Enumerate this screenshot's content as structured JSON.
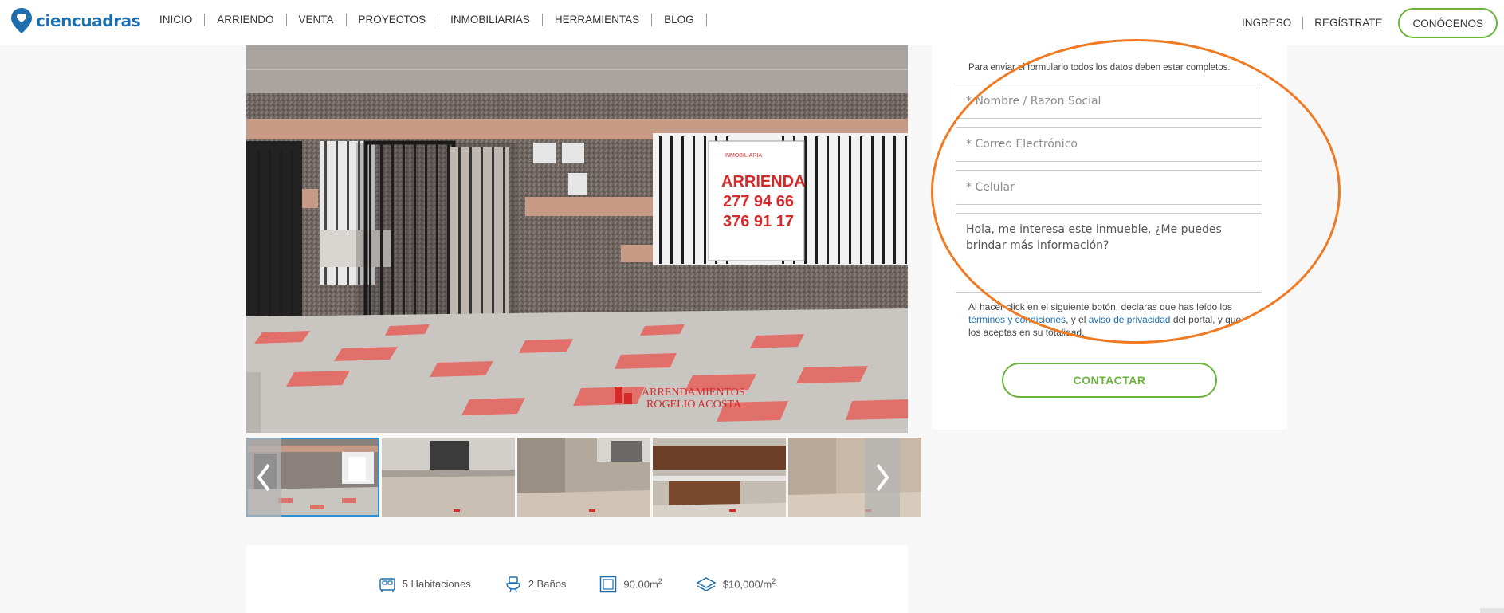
{
  "header": {
    "logo_text": "ciencuadras",
    "nav": [
      "INICIO",
      "ARRIENDO",
      "VENTA",
      "PROYECTOS",
      "INMOBILIARIAS",
      "HERRAMIENTAS",
      "BLOG"
    ],
    "login": "INGRESO",
    "register": "REGÍSTRATE",
    "cta": "CONÓCENOS"
  },
  "photo": {
    "sign_line1": "ARRIENDA",
    "sign_line2": "277 94 66",
    "sign_line3": "376 91 17",
    "watermark_line1": "ARRENDAMIENTOS",
    "watermark_line2": "ROGELIO ACOSTA"
  },
  "features": {
    "rooms": "5 Habitaciones",
    "baths": "2 Baños",
    "area": "90.00m",
    "price_per_m2": "$10,000/m",
    "area_sup": "2",
    "price_sup": "2"
  },
  "form": {
    "note": "Para enviar el formulario todos los datos deben estar completos.",
    "name_placeholder": "* Nombre / Razon Social",
    "email_placeholder": "* Correo Electrónico",
    "phone_placeholder": "* Celular",
    "message": "Hola, me interesa este inmueble. ¿Me puedes brindar más información?",
    "legal_prefix": "Al hacer click en el siguiente botón, declaras que has leído los ",
    "terms_link": "términos y condiciones",
    "legal_mid": ", y el ",
    "privacy_link": "aviso de privacidad",
    "legal_suffix": " del portal, y que los aceptas en su totalidad.",
    "submit": "CONTACTAR"
  },
  "colors": {
    "brand_blue": "#1f6fae",
    "accent_green": "#6bb33a",
    "annotation_orange": "#f07a22"
  }
}
